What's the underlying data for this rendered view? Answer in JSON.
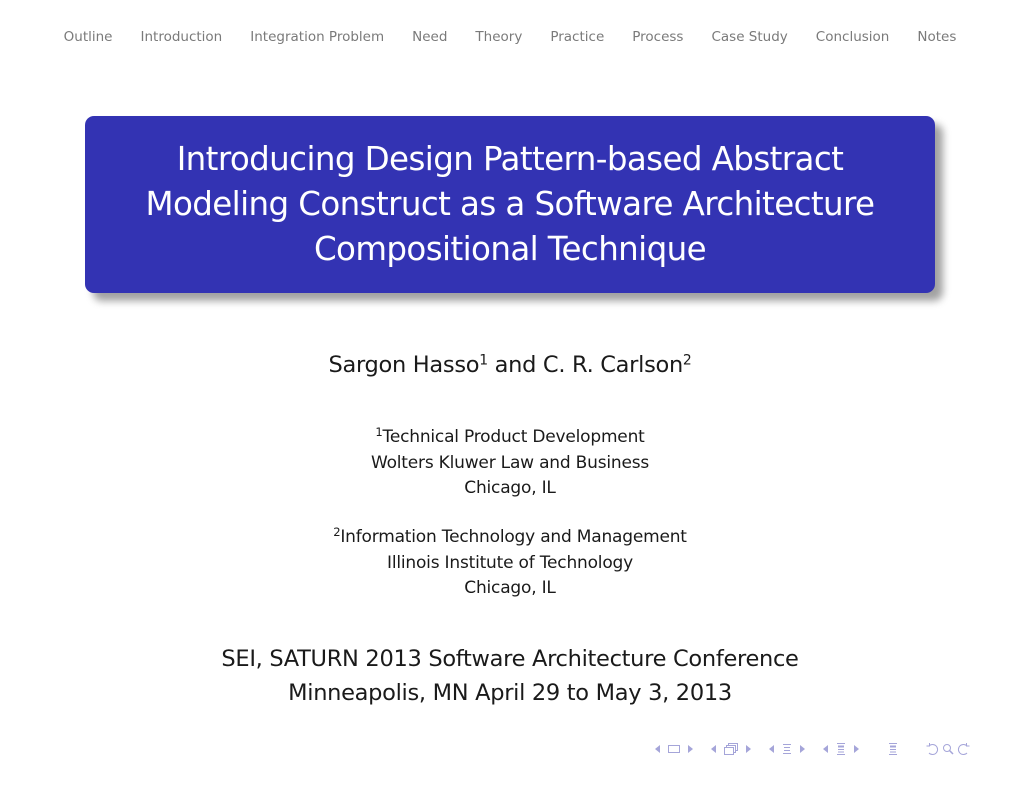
{
  "nav": {
    "items": [
      {
        "label": "Outline"
      },
      {
        "label": "Introduction"
      },
      {
        "label": "Integration Problem"
      },
      {
        "label": "Need"
      },
      {
        "label": "Theory"
      },
      {
        "label": "Practice"
      },
      {
        "label": "Process"
      },
      {
        "label": "Case Study"
      },
      {
        "label": "Conclusion"
      },
      {
        "label": "Notes"
      }
    ]
  },
  "title": {
    "lines": [
      "Introducing Design Pattern-based Abstract",
      "Modeling Construct as a Software Architecture",
      "Compositional Technique"
    ],
    "background_color": "#3333b3"
  },
  "authors": {
    "author1": "Sargon Hasso",
    "author1_mark": "1",
    "connector": " and ",
    "author2": "C. R. Carlson",
    "author2_mark": "2"
  },
  "affiliations": [
    {
      "mark": "1",
      "lines": [
        "Technical Product Development",
        "Wolters Kluwer Law and Business",
        "Chicago, IL"
      ]
    },
    {
      "mark": "2",
      "lines": [
        "Information Technology and Management",
        "Illinois Institute of Technology",
        "Chicago, IL"
      ]
    }
  ],
  "conference": {
    "lines": [
      "SEI, SATURN 2013 Software Architecture Conference",
      "Minneapolis, MN April 29 to May 3, 2013"
    ]
  },
  "navigation_symbols": {
    "icons": [
      "arrow-left",
      "frame",
      "arrow-right",
      "arrow-left",
      "subsection",
      "arrow-right",
      "arrow-left",
      "section",
      "arrow-right",
      "arrow-left",
      "subsection-doc",
      "arrow-right",
      "document",
      "undo",
      "search",
      "redo"
    ],
    "color": "#a5a5d9"
  }
}
